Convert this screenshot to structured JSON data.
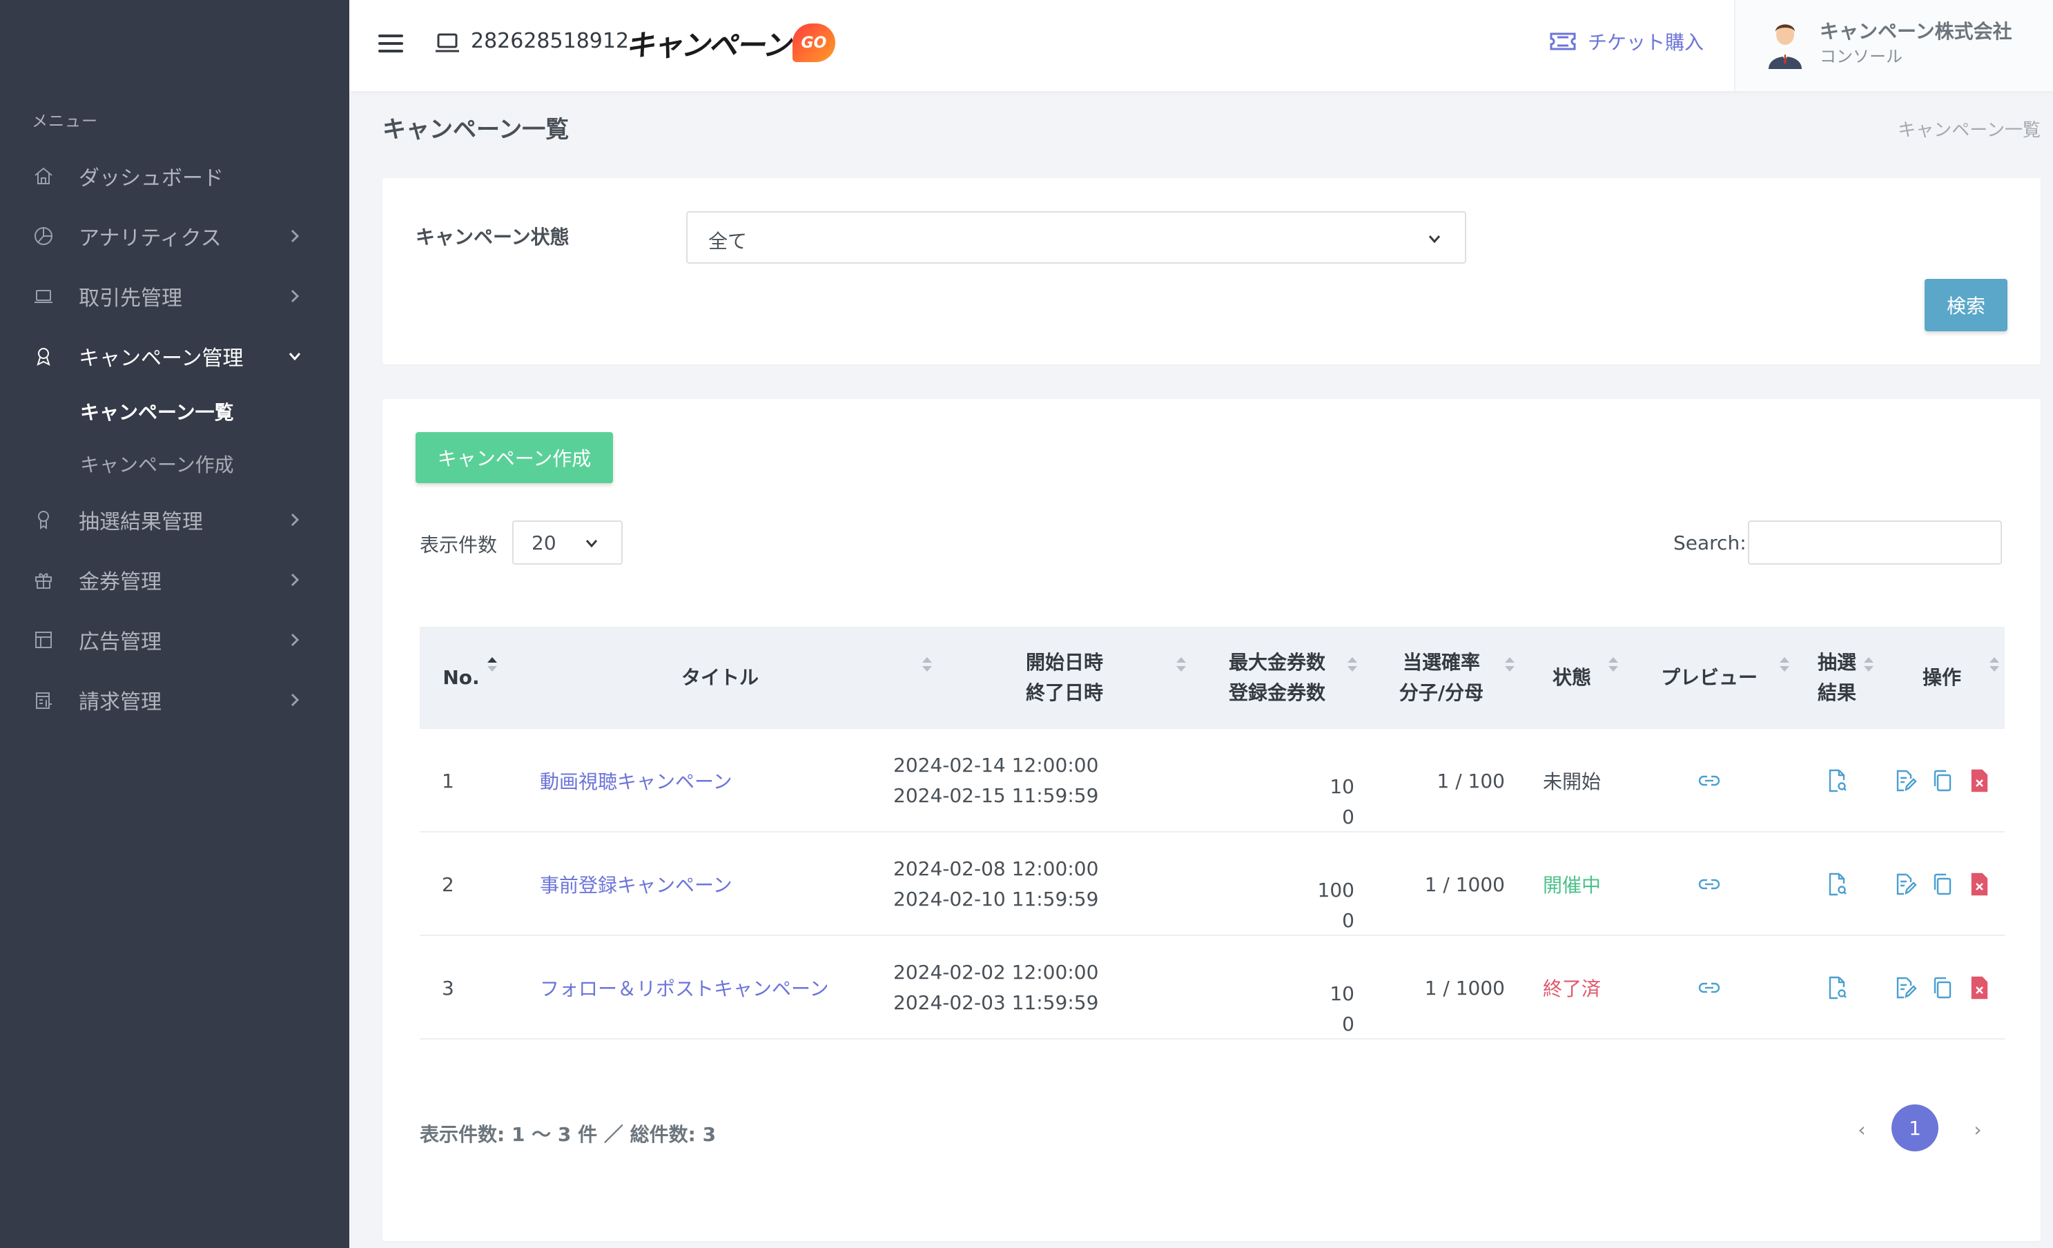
{
  "sidebar": {
    "menu_heading": "メニュー",
    "items": [
      {
        "label": "ダッシュボード"
      },
      {
        "label": "アナリティクス"
      },
      {
        "label": "取引先管理"
      },
      {
        "label": "キャンペーン管理"
      },
      {
        "label": "抽選結果管理"
      },
      {
        "label": "金券管理"
      },
      {
        "label": "広告管理"
      },
      {
        "label": "請求管理"
      }
    ],
    "sub_items": [
      {
        "label": "キャンペーン一覧"
      },
      {
        "label": "キャンペーン作成"
      }
    ]
  },
  "topbar": {
    "account_id": "282628518912",
    "logo_text": "キャンペーン",
    "logo_badge": "GO",
    "ticket_label": "チケット購入",
    "company_name": "キャンペーン株式会社",
    "role": "コンソール"
  },
  "page": {
    "title": "キャンペーン一覧",
    "breadcrumb": "キャンペーン一覧"
  },
  "filter": {
    "label": "キャンペーン状態",
    "selected": "全て",
    "search_button": "検索"
  },
  "list": {
    "create_button": "キャンペーン作成",
    "length_label": "表示件数",
    "length_value": "20",
    "search_label": "Search:",
    "search_value": "",
    "columns": {
      "no": "No.",
      "title": "タイトル",
      "start": "開始日時",
      "end": "終了日時",
      "max": "最大金券数",
      "registered": "登録金券数",
      "rate": "当選確率",
      "fraction": "分子/分母",
      "status": "状態",
      "preview": "プレビュー",
      "result1": "抽選",
      "result2": "結果",
      "actions": "操作"
    },
    "rows": [
      {
        "no": "1",
        "title": "動画視聴キャンペーン",
        "start": "2024-02-14 12:00:00",
        "end": "2024-02-15 11:59:59",
        "max": "10",
        "registered": "0",
        "rate": "1 / 100",
        "status": "未開始"
      },
      {
        "no": "2",
        "title": "事前登録キャンペーン",
        "start": "2024-02-08 12:00:00",
        "end": "2024-02-10 11:59:59",
        "max": "100",
        "registered": "0",
        "rate": "1 / 1000",
        "status": "開催中"
      },
      {
        "no": "3",
        "title": "フォロー＆リポストキャンペーン",
        "start": "2024-02-02 12:00:00",
        "end": "2024-02-03 11:59:59",
        "max": "10",
        "registered": "0",
        "rate": "1 / 1000",
        "status": "終了済"
      }
    ],
    "summary": "表示件数: 1 〜 3 件 ／ 総件数: 3",
    "pager": {
      "prev": "‹",
      "page": "1",
      "next": "›"
    }
  },
  "colors": {
    "sidebar_bg": "#353b48",
    "accent": "#6c75d8",
    "search_button": "#5ba7c9",
    "create_button": "#5ad099",
    "status_open": "#4cc18a",
    "status_ended": "#e0566b"
  }
}
